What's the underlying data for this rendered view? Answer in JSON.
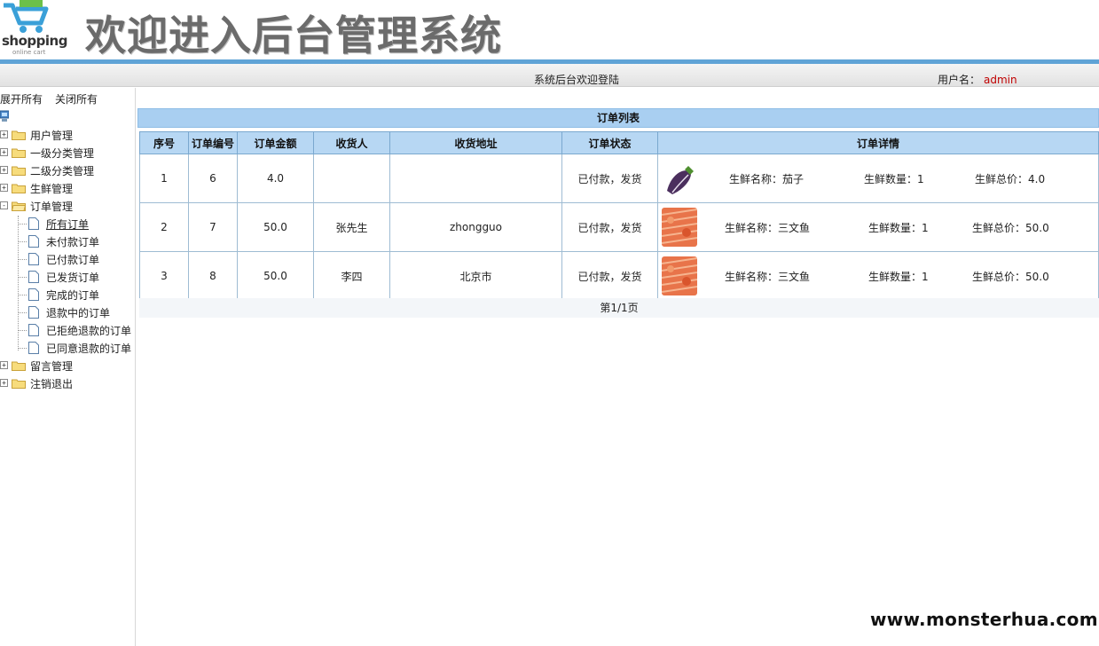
{
  "header": {
    "logo_text": "shopping",
    "logo_sub": "online cart",
    "title": "欢迎进入后台管理系统",
    "welcome": "系统后台欢迎登陆",
    "user_label": "用户名：",
    "user_name": "admin"
  },
  "sidebar": {
    "expand_all": "展开所有",
    "collapse_all": "关闭所有",
    "nodes": [
      {
        "label": "用户管理",
        "toggle": "+"
      },
      {
        "label": "一级分类管理",
        "toggle": "+"
      },
      {
        "label": "二级分类管理",
        "toggle": "+"
      },
      {
        "label": "生鲜管理",
        "toggle": "+"
      },
      {
        "label": "订单管理",
        "toggle": "-"
      }
    ],
    "order_children": [
      "所有订单",
      "未付款订单",
      "已付款订单",
      "已发货订单",
      "完成的订单",
      "退款中的订单",
      "已拒绝退款的订单",
      "已同意退款的订单"
    ],
    "tail_nodes": [
      {
        "label": "留言管理",
        "toggle": "+"
      },
      {
        "label": "注销退出",
        "toggle": "+"
      }
    ]
  },
  "main": {
    "panel_title": "订单列表",
    "columns": [
      "序号",
      "订单编号",
      "订单金额",
      "收货人",
      "收货地址",
      "订单状态",
      "订单详情"
    ],
    "rows": [
      {
        "index": "1",
        "order_no": "6",
        "amount": "4.0",
        "receiver": "",
        "address": "",
        "status_text": "已付款，",
        "status_action": "发货",
        "product_icon": "eggplant-thumbnail",
        "name_label": "生鲜名称：",
        "name": "茄子",
        "qty_label": "生鲜数量：",
        "qty": "1",
        "total_label": "生鲜总价：",
        "total": "4.0"
      },
      {
        "index": "2",
        "order_no": "7",
        "amount": "50.0",
        "receiver": "张先生",
        "address": "zhongguo",
        "status_text": "已付款，",
        "status_action": "发货",
        "product_icon": "salmon-thumbnail",
        "name_label": "生鲜名称：",
        "name": "三文鱼",
        "qty_label": "生鲜数量：",
        "qty": "1",
        "total_label": "生鲜总价：",
        "total": "50.0"
      },
      {
        "index": "3",
        "order_no": "8",
        "amount": "50.0",
        "receiver": "李四",
        "address": "北京市",
        "status_text": "已付款，",
        "status_action": "发货",
        "product_icon": "salmon-thumbnail",
        "name_label": "生鲜名称：",
        "name": "三文鱼",
        "qty_label": "生鲜数量：",
        "qty": "1",
        "total_label": "生鲜总价：",
        "total": "50.0"
      }
    ],
    "pager": "第1/1页"
  },
  "watermark": "www.monsterhua.com",
  "colors": {
    "accent_rule": "#5fa3d6",
    "table_header": "#b7d7f3",
    "user_name": "#c00000"
  }
}
